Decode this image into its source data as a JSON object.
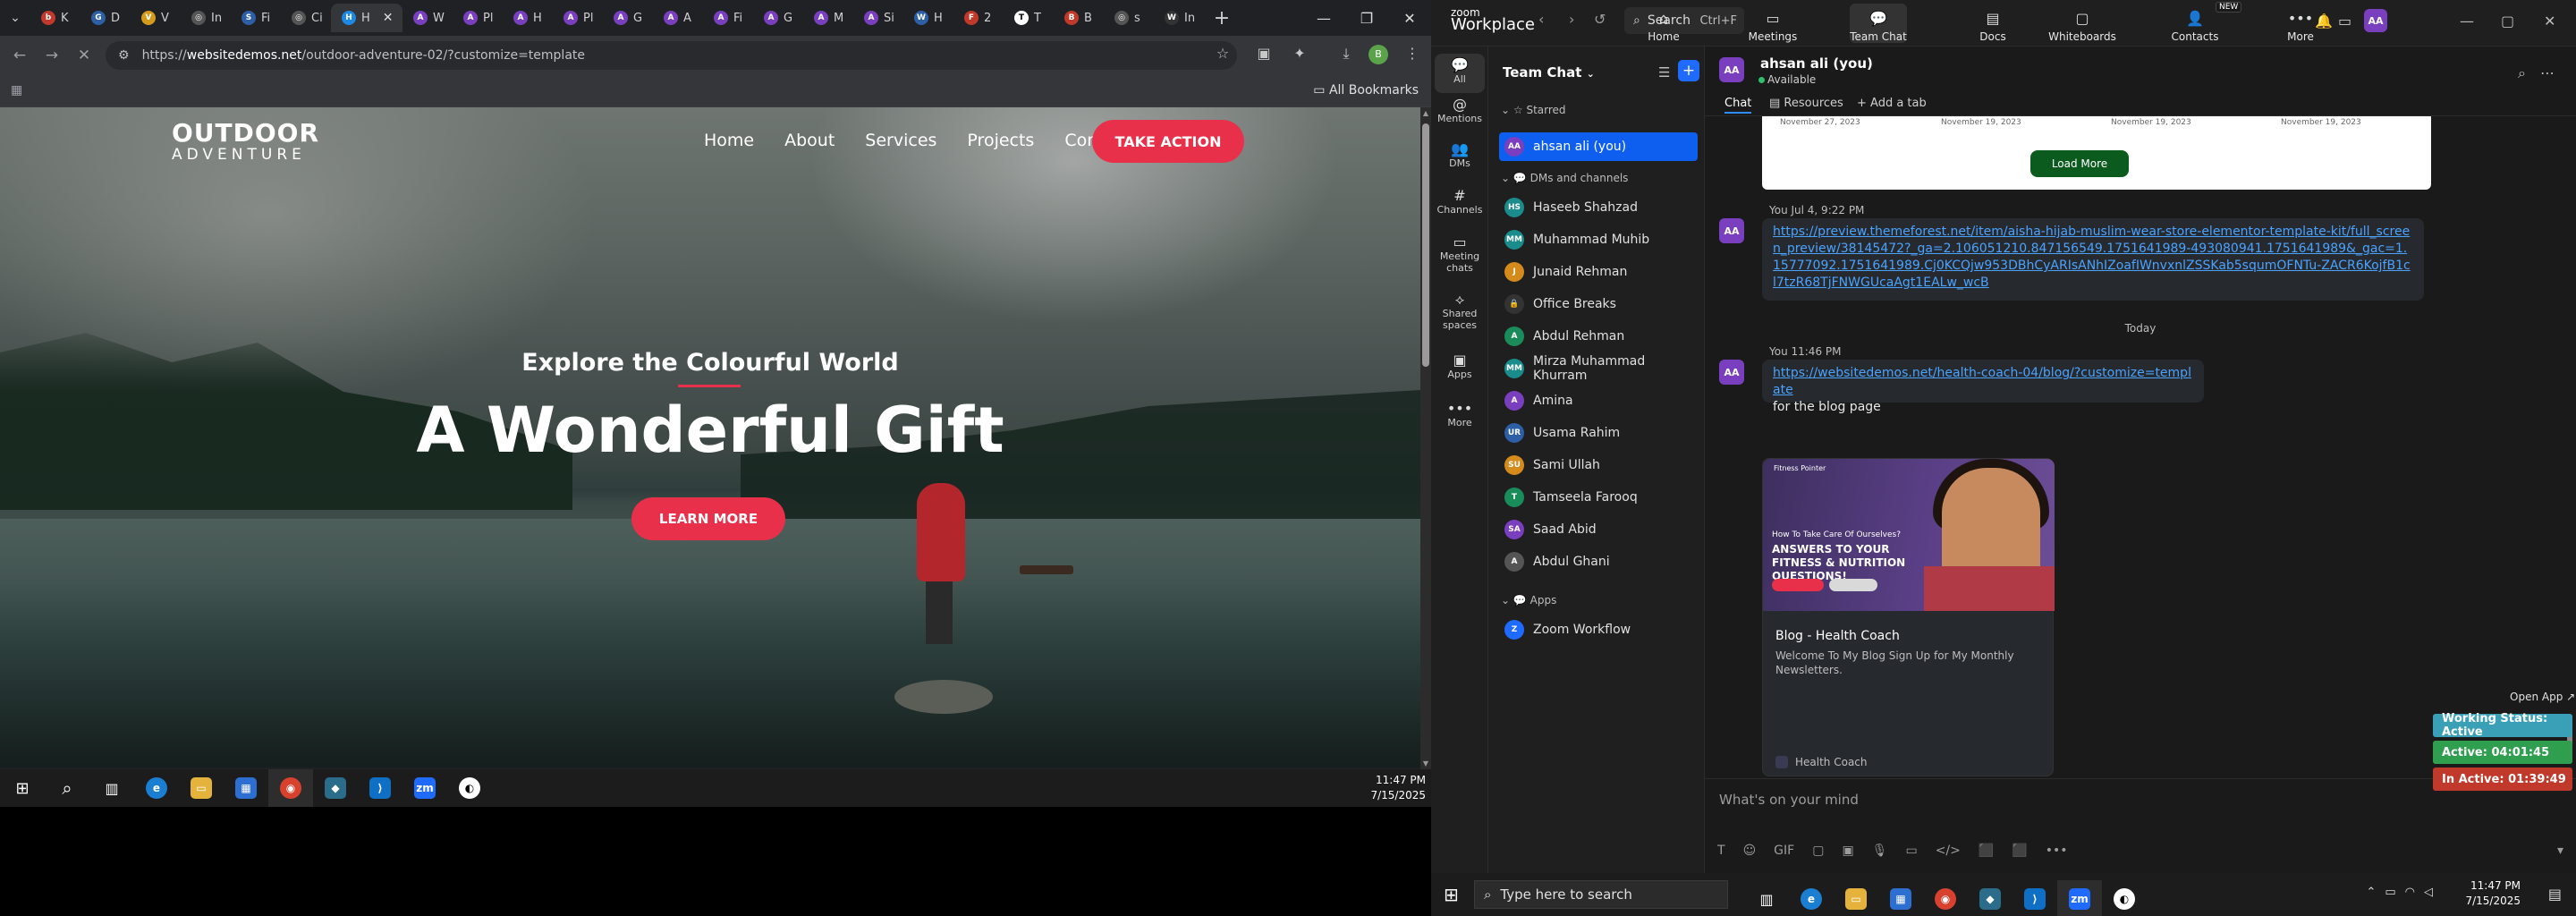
{
  "browser": {
    "tabs": [
      {
        "label": "K",
        "color": "#c0392b",
        "glyph": "b"
      },
      {
        "label": "D",
        "color": "#2d5fa6",
        "glyph": "G"
      },
      {
        "label": "V",
        "color": "#d59a1c",
        "glyph": "V"
      },
      {
        "label": "In",
        "color": "#555",
        "glyph": "◎"
      },
      {
        "label": "Fi",
        "color": "#2d5fa6",
        "glyph": "S"
      },
      {
        "label": "Ci",
        "color": "#555",
        "glyph": "◎"
      },
      {
        "label": "H",
        "color": "#1e88e5",
        "glyph": "H",
        "active": true
      },
      {
        "label": "W",
        "color": "#7a3fbf",
        "glyph": "A"
      },
      {
        "label": "Pl",
        "color": "#7a3fbf",
        "glyph": "A"
      },
      {
        "label": "H",
        "color": "#7a3fbf",
        "glyph": "A"
      },
      {
        "label": "Pl",
        "color": "#7a3fbf",
        "glyph": "A"
      },
      {
        "label": "G",
        "color": "#7a3fbf",
        "glyph": "A"
      },
      {
        "label": "A",
        "color": "#7a3fbf",
        "glyph": "A"
      },
      {
        "label": "Fi",
        "color": "#7a3fbf",
        "glyph": "A"
      },
      {
        "label": "G",
        "color": "#7a3fbf",
        "glyph": "A"
      },
      {
        "label": "M",
        "color": "#7a3fbf",
        "glyph": "A"
      },
      {
        "label": "Si",
        "color": "#7a3fbf",
        "glyph": "A"
      },
      {
        "label": "H",
        "color": "#2d5fa6",
        "glyph": "W"
      },
      {
        "label": "2",
        "color": "#c0392b",
        "glyph": "F"
      },
      {
        "label": "T",
        "color": "#fff",
        "glyph": "T"
      },
      {
        "label": "B",
        "color": "#c0392b",
        "glyph": "B"
      },
      {
        "label": "s",
        "color": "#555",
        "glyph": "◎"
      },
      {
        "label": "In",
        "color": "#333",
        "glyph": "W"
      }
    ],
    "new_tab": "+",
    "url_domain": "websitedemos.net",
    "url_prefix": "https://",
    "url_path": "/outdoor-adventure-02/?customize=template",
    "all_bookmarks": "All Bookmarks",
    "window": {
      "minimize": "—",
      "maximize": "❐",
      "close": "✕"
    }
  },
  "site": {
    "logo_top": "OUTDOOR",
    "logo_bottom": "ADVENTURE",
    "nav": [
      "Home",
      "About",
      "Services",
      "Projects",
      "Contact"
    ],
    "cta": "TAKE ACTION",
    "subtitle": "Explore the Colourful World",
    "headline": "A Wonderful Gift",
    "button": "LEARN MORE",
    "accent": "#e8304a"
  },
  "left_taskbar": {
    "time": "11:47 PM",
    "date": "7/15/2025"
  },
  "zoom": {
    "brand_top": "zoom",
    "brand_bottom": "Workplace",
    "search": "Search",
    "search_kbd": "Ctrl+F",
    "nav": [
      {
        "label": "Home",
        "icon": "⌂"
      },
      {
        "label": "Meetings",
        "icon": "▭"
      },
      {
        "label": "Team Chat",
        "icon": "💬",
        "active": true
      },
      {
        "label": "Docs",
        "icon": "▤"
      },
      {
        "label": "Whiteboards",
        "icon": "▢"
      },
      {
        "label": "Contacts",
        "icon": "👤"
      },
      {
        "label": "More",
        "icon": "•••"
      }
    ],
    "new_badge": "NEW",
    "avatar": "AA",
    "rail": [
      {
        "label": "All",
        "icon": "💬",
        "active": true
      },
      {
        "label": "Mentions",
        "icon": "@"
      },
      {
        "label": "DMs",
        "icon": "👥"
      },
      {
        "label": "Channels",
        "icon": "#"
      },
      {
        "label": "Meeting chats",
        "icon": "▭"
      },
      {
        "label": "Shared spaces",
        "icon": "⟡"
      },
      {
        "label": "Apps",
        "icon": "▣"
      },
      {
        "label": "More",
        "icon": "•••"
      }
    ],
    "chlist_title": "Team Chat",
    "sections": {
      "starred": "Starred",
      "dms": "DMs and channels",
      "apps": "Apps"
    },
    "starred": [
      {
        "name": "ahsan ali (you)",
        "initials": "AA",
        "color": "#7a3fbf"
      }
    ],
    "contacts": [
      {
        "name": "Haseeb Shahzad",
        "initials": "HS",
        "color": "#1a8c8c"
      },
      {
        "name": "Muhammad Muhib",
        "initials": "MM",
        "color": "#1a8c8c"
      },
      {
        "name": "Junaid Rehman",
        "initials": "J",
        "color": "#d58a1c"
      },
      {
        "name": "Office Breaks",
        "initials": "🔒",
        "color": "#333"
      },
      {
        "name": "Abdul Rehman",
        "initials": "A",
        "color": "#1a8c5a"
      },
      {
        "name": "Mirza Muhammad Khurram",
        "initials": "MM",
        "color": "#1a8c8c"
      },
      {
        "name": "Amina",
        "initials": "A",
        "color": "#7a3fbf"
      },
      {
        "name": "Usama Rahim",
        "initials": "UR",
        "color": "#2d5fa6"
      },
      {
        "name": "Sami Ullah",
        "initials": "SU",
        "color": "#d58a1c"
      },
      {
        "name": "Tamseela Farooq",
        "initials": "T",
        "color": "#1a8c5a"
      },
      {
        "name": "Saad Abid",
        "initials": "SA",
        "color": "#7a3fbf"
      },
      {
        "name": "Abdul Ghani",
        "initials": "A",
        "color": "#555"
      }
    ],
    "apps": [
      {
        "name": "Zoom Workflow",
        "initials": "Z",
        "color": "#1f6bff"
      }
    ],
    "chat_name": "ahsan ali (you)",
    "chat_status": "Available",
    "tabs": {
      "chat": "Chat",
      "resources": "Resources",
      "add": "+ Add a tab"
    },
    "card_dates": [
      "November 27, 2023",
      "November 19, 2023",
      "November 19, 2023",
      "November 19, 2023"
    ],
    "load_more": "Load More",
    "msg1_meta": "You Jul 4, 9:22 PM",
    "msg1_link": "https://preview.themeforest.net/item/aisha-hijab-muslim-wear-store-elementor-template-kit/full_screen_preview/38145472?_ga=2.106051210.847156549.1751641989-493080941.1751641989&_gac=1.15777092.1751641989.Cj0KCQjw953DBhCyARIsANhIZoafIWnvxnlZSSKab5squmOFNTu-ZACR6KojfB1cl7tzR68TjFNWGUcaAgt1EALw_wcB",
    "today": "Today",
    "msg2_meta": "You 11:46 PM",
    "msg2_link": "https://websitedemos.net/health-coach-04/blog/?customize=template",
    "msg2_text": "for the blog page",
    "preview": {
      "brand": "Fitness Pointer",
      "small": "How To Take Care Of Ourselves?",
      "big": "ANSWERS TO YOUR FITNESS & NUTRITION QUESTIONS!",
      "title": "Blog - Health Coach",
      "desc": "Welcome To My Blog Sign Up for My Monthly Newsletters.",
      "site": "Health Coach"
    },
    "composer_placeholder": "What's on your mind",
    "composer_tools": [
      "T",
      "☺",
      "GIF",
      "▢",
      "▣",
      "🎙",
      "▭",
      "</>",
      "⬛",
      "⬛",
      "•••"
    ],
    "open_app": "Open App ↗",
    "status": [
      {
        "text": "Working Status: Active",
        "color": "#3aa0b8"
      },
      {
        "text": "Active: 04:01:45",
        "color": "#2f9e4f"
      },
      {
        "text": "In Active: 01:39:49",
        "color": "#c0392b"
      }
    ]
  },
  "right_taskbar": {
    "search": "Type here to search",
    "time": "11:47 PM",
    "date": "7/15/2025"
  }
}
